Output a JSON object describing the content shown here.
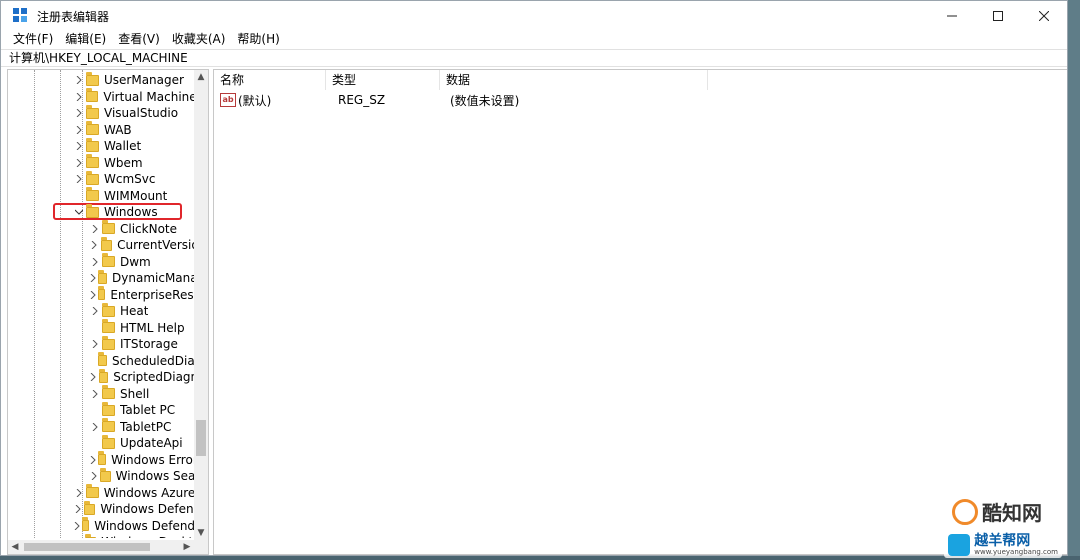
{
  "window": {
    "title": "注册表编辑器",
    "controls": {
      "minimize": "minimize",
      "maximize": "maximize",
      "close": "close"
    }
  },
  "menu": [
    {
      "label": "文件(F)"
    },
    {
      "label": "编辑(E)"
    },
    {
      "label": "查看(V)"
    },
    {
      "label": "收藏夹(A)"
    },
    {
      "label": "帮助(H)"
    }
  ],
  "address": "计算机\\HKEY_LOCAL_MACHINE",
  "tree": {
    "nodes": [
      {
        "label": "UserManager",
        "level": 0,
        "expander": ">"
      },
      {
        "label": "Virtual Machine",
        "level": 0,
        "expander": ">"
      },
      {
        "label": "VisualStudio",
        "level": 0,
        "expander": ">"
      },
      {
        "label": "WAB",
        "level": 0,
        "expander": ">"
      },
      {
        "label": "Wallet",
        "level": 0,
        "expander": ">"
      },
      {
        "label": "Wbem",
        "level": 0,
        "expander": ">"
      },
      {
        "label": "WcmSvc",
        "level": 0,
        "expander": ">"
      },
      {
        "label": "WIMMount",
        "level": 0,
        "expander": ""
      },
      {
        "label": "Windows",
        "level": 0,
        "expander": "v",
        "selected": true
      },
      {
        "label": "ClickNote",
        "level": 1,
        "expander": ">"
      },
      {
        "label": "CurrentVersion",
        "level": 1,
        "expander": ">"
      },
      {
        "label": "Dwm",
        "level": 1,
        "expander": ">"
      },
      {
        "label": "DynamicManagement",
        "level": 1,
        "expander": ">"
      },
      {
        "label": "EnterpriseResourceManager",
        "level": 1,
        "expander": ">"
      },
      {
        "label": "Heat",
        "level": 1,
        "expander": ">"
      },
      {
        "label": "HTML Help",
        "level": 1,
        "expander": ""
      },
      {
        "label": "ITStorage",
        "level": 1,
        "expander": ">"
      },
      {
        "label": "ScheduledDiagnostics",
        "level": 1,
        "expander": ""
      },
      {
        "label": "ScriptedDiagnostics",
        "level": 1,
        "expander": ">"
      },
      {
        "label": "Shell",
        "level": 1,
        "expander": ">"
      },
      {
        "label": "Tablet PC",
        "level": 1,
        "expander": ""
      },
      {
        "label": "TabletPC",
        "level": 1,
        "expander": ">"
      },
      {
        "label": "UpdateApi",
        "level": 1,
        "expander": ""
      },
      {
        "label": "Windows Error Reporting",
        "level": 1,
        "expander": ">"
      },
      {
        "label": "Windows Search",
        "level": 1,
        "expander": ">"
      },
      {
        "label": "Windows Azure",
        "level": 0,
        "expander": ">"
      },
      {
        "label": "Windows Defender",
        "level": 0,
        "expander": ">"
      },
      {
        "label": "Windows Defender Security Center",
        "level": 0,
        "expander": ">"
      },
      {
        "label": "Windows Desktop",
        "level": 0,
        "expander": ">"
      }
    ]
  },
  "list": {
    "columns": [
      "名称",
      "类型",
      "数据"
    ],
    "rows": [
      {
        "icon": "ab",
        "name": "(默认)",
        "type": "REG_SZ",
        "data": "(数值未设置)"
      }
    ]
  },
  "watermark": {
    "brand1": "酷知网",
    "brand2": "越羊帮网",
    "url": "www.yueyangbang.com"
  },
  "colors": {
    "highlight": "#e0262b",
    "folder": "#f2c94c",
    "accent": "#1e6fc8"
  }
}
